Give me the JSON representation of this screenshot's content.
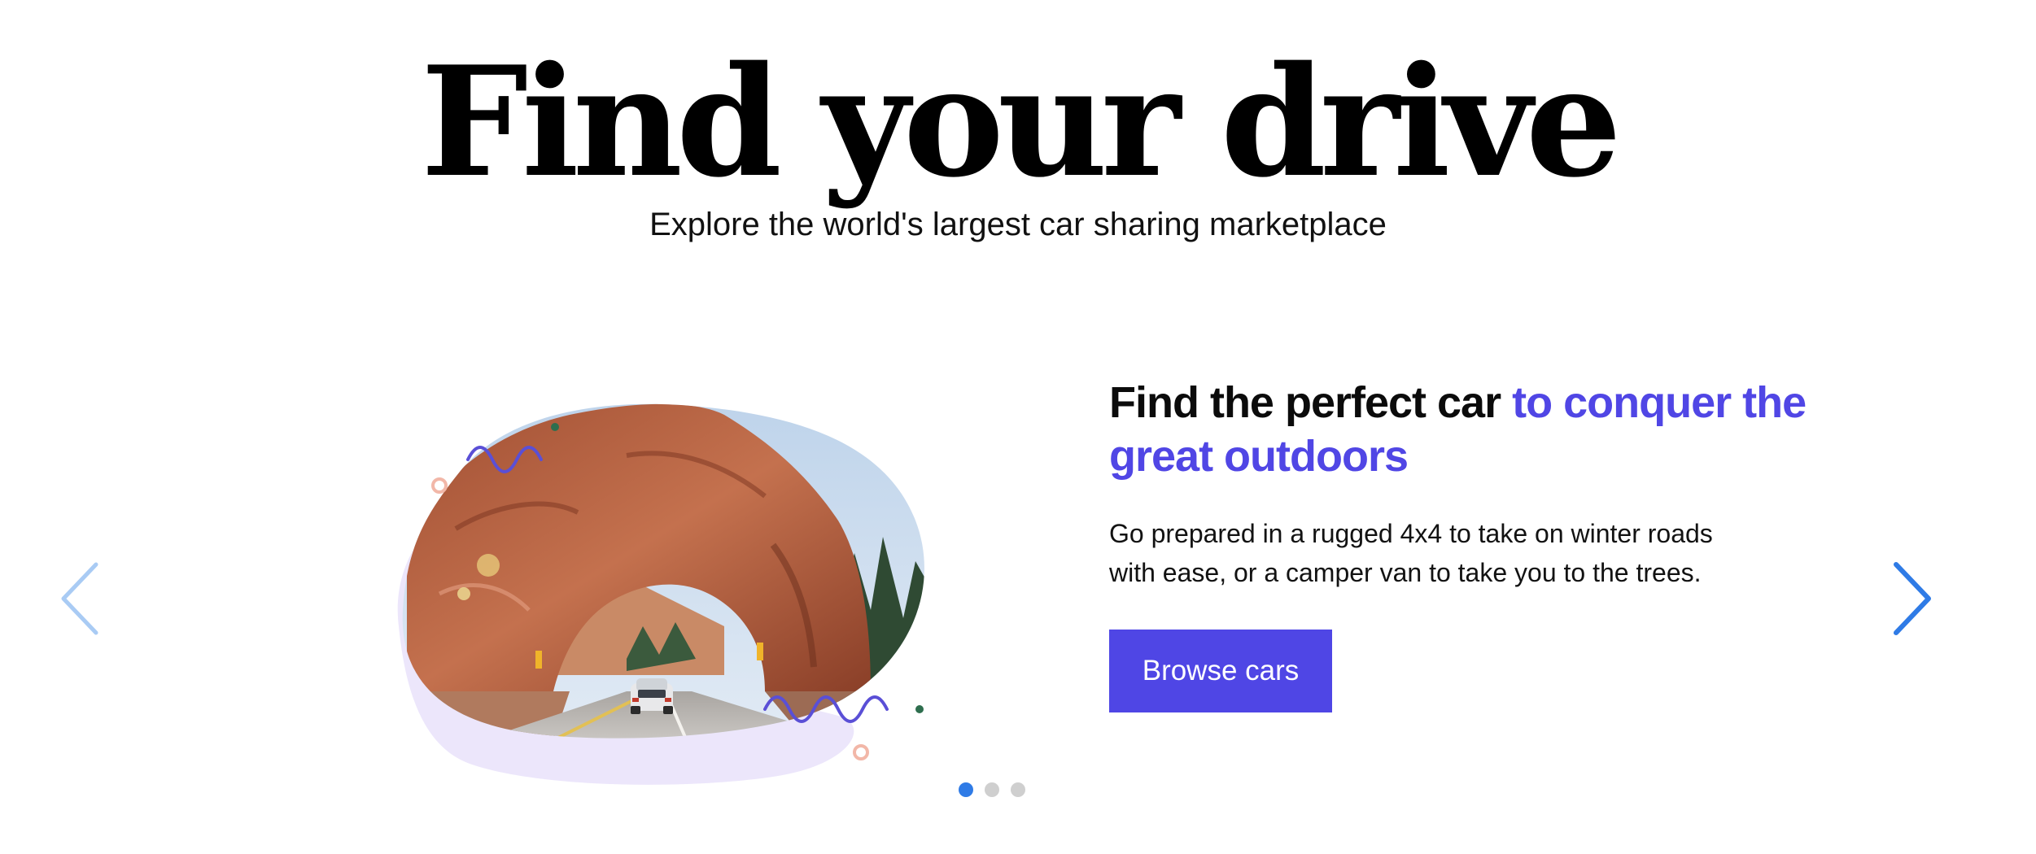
{
  "hero": {
    "title": "Find your drive",
    "subtitle": "Explore the world's largest car sharing marketplace"
  },
  "slide": {
    "heading_main": "Find the perfect car ",
    "heading_accent": "to conquer the great outdoors",
    "body": "Go prepared in a rugged 4x4 to take on winter roads with ease, or a camper van to take you to the trees.",
    "cta_label": "Browse cars"
  },
  "carousel": {
    "prev_icon": "chevron-left-icon",
    "next_icon": "chevron-right-icon",
    "total_slides": 3,
    "active_slide": 1
  },
  "colors": {
    "accent": "#4f46e5",
    "accent_text": "#5046e5",
    "dot_active": "#2f7be6",
    "dot_inactive": "#cfcfcf",
    "arrow_prev": "#a9cbf4",
    "arrow_next": "#2f7be6",
    "blob_lavender": "#ece6fb"
  }
}
